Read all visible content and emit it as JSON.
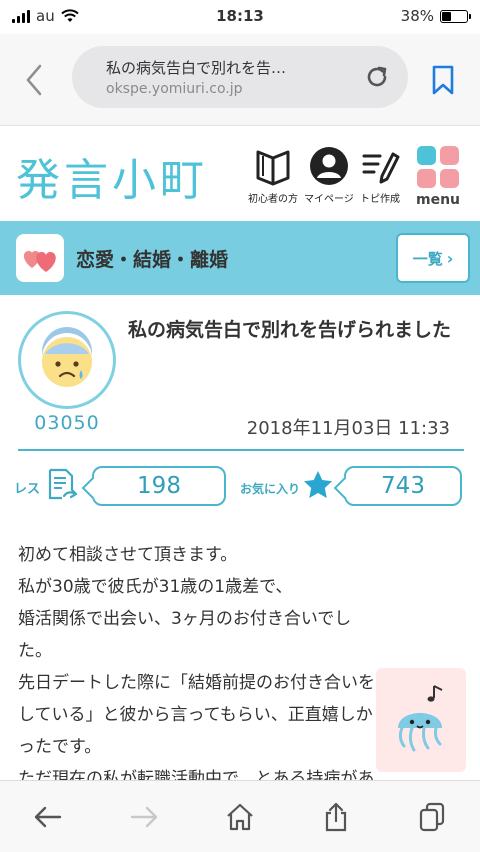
{
  "status_bar": {
    "carrier": "au",
    "time": "18:13",
    "battery": "38%",
    "battery_level": 0.38
  },
  "browser": {
    "page_title": "私の病気告白で別れを告…",
    "url": "okspe.yomiuri.co.jp",
    "icons": {
      "back": "chevron-left-icon",
      "reload": "reload-icon",
      "bookmark": "bookmark-icon"
    }
  },
  "site": {
    "logo": "発言小町",
    "nav": [
      {
        "label": "初心者の方",
        "icon": "book-icon"
      },
      {
        "label": "マイページ",
        "icon": "person-icon"
      },
      {
        "label": "トピ作成",
        "icon": "pen-icon"
      }
    ],
    "menu_label": "menu",
    "menu_colors": [
      "#4ec3d8",
      "#f39ea4",
      "#f39ea4",
      "#f39ea4"
    ]
  },
  "category": {
    "title": "恋愛・結婚・離婚",
    "list_button": "一覧",
    "colors": {
      "bar": "#79cde0",
      "accent": "#4ab6cd"
    }
  },
  "topic": {
    "title": "私の病気告白で別れを告げられました",
    "user_id": "03050",
    "date": "2018年11月03日 11:33",
    "avatar_emoji": "😰",
    "res_label": "レス",
    "res_count": "198",
    "fav_label": "お気に入り",
    "fav_count": "743"
  },
  "body_lines": [
    "初めて相談させて頂きます。",
    "私が30歳で彼氏が31歳の1歳差で、",
    "婚活関係で出会い、3ヶ月のお付き合いでし",
    "た。",
    "先日デートした際に「結婚前提のお付き合いを",
    "している」と彼から言ってもらい、正直嬉しか",
    "ったです。",
    "ただ現在の私が転職活動中で、とある持病があ"
  ],
  "toolbar": {
    "icons": [
      "back-arrow-icon",
      "forward-arrow-icon",
      "home-icon",
      "share-icon",
      "tabs-icon"
    ]
  }
}
